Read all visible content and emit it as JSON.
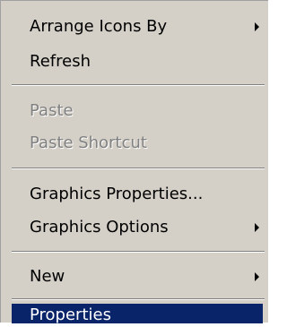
{
  "context_menu": {
    "items": [
      {
        "label": "Arrange Icons By",
        "submenu": true,
        "disabled": false
      },
      {
        "label": "Refresh",
        "submenu": false,
        "disabled": false
      },
      {
        "label": "Paste",
        "submenu": false,
        "disabled": true
      },
      {
        "label": "Paste Shortcut",
        "submenu": false,
        "disabled": true
      },
      {
        "label": "Graphics Properties...",
        "submenu": false,
        "disabled": false
      },
      {
        "label": "Graphics Options",
        "submenu": true,
        "disabled": false
      },
      {
        "label": "New",
        "submenu": true,
        "disabled": false
      },
      {
        "label": "Properties",
        "submenu": false,
        "disabled": false,
        "selected": true
      }
    ]
  },
  "colors": {
    "menu_background": "#d4d0c8",
    "highlight": "#0a246a",
    "disabled_text": "#808080"
  }
}
